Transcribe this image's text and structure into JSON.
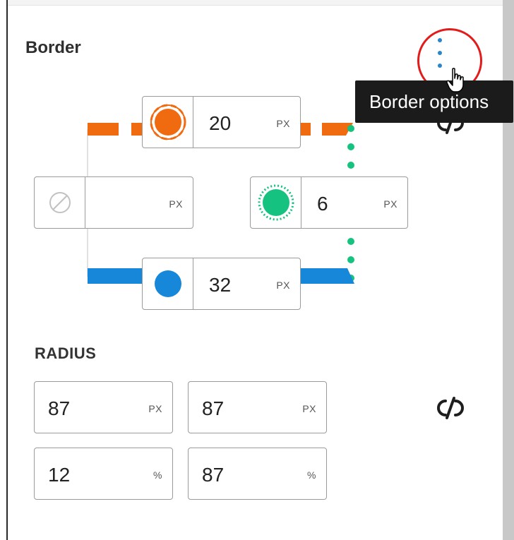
{
  "border": {
    "title": "Border",
    "more_icon": "vertical-ellipsis-icon",
    "tooltip": "Border options",
    "link_icon": "unlink-icon",
    "top": {
      "value": "20",
      "unit": "PX",
      "style": "dashed",
      "color": "#f06a0f"
    },
    "left": {
      "value": "",
      "unit": "PX",
      "style": "none",
      "color": "#c0c0c0"
    },
    "right": {
      "value": "6",
      "unit": "PX",
      "style": "dotted",
      "color": "#16c27f"
    },
    "bottom": {
      "value": "32",
      "unit": "PX",
      "style": "solid",
      "color": "#1687d9"
    }
  },
  "radius": {
    "title": "RADIUS",
    "link_icon": "unlink-icon",
    "corners": [
      {
        "value": "87",
        "unit": "PX"
      },
      {
        "value": "87",
        "unit": "PX"
      },
      {
        "value": "12",
        "unit": "%"
      },
      {
        "value": "87",
        "unit": "%"
      }
    ]
  },
  "colors": {
    "accent_blue": "#2b86c9",
    "highlight_ring": "#e21b1b",
    "tooltip_bg": "#1b1b1b"
  }
}
